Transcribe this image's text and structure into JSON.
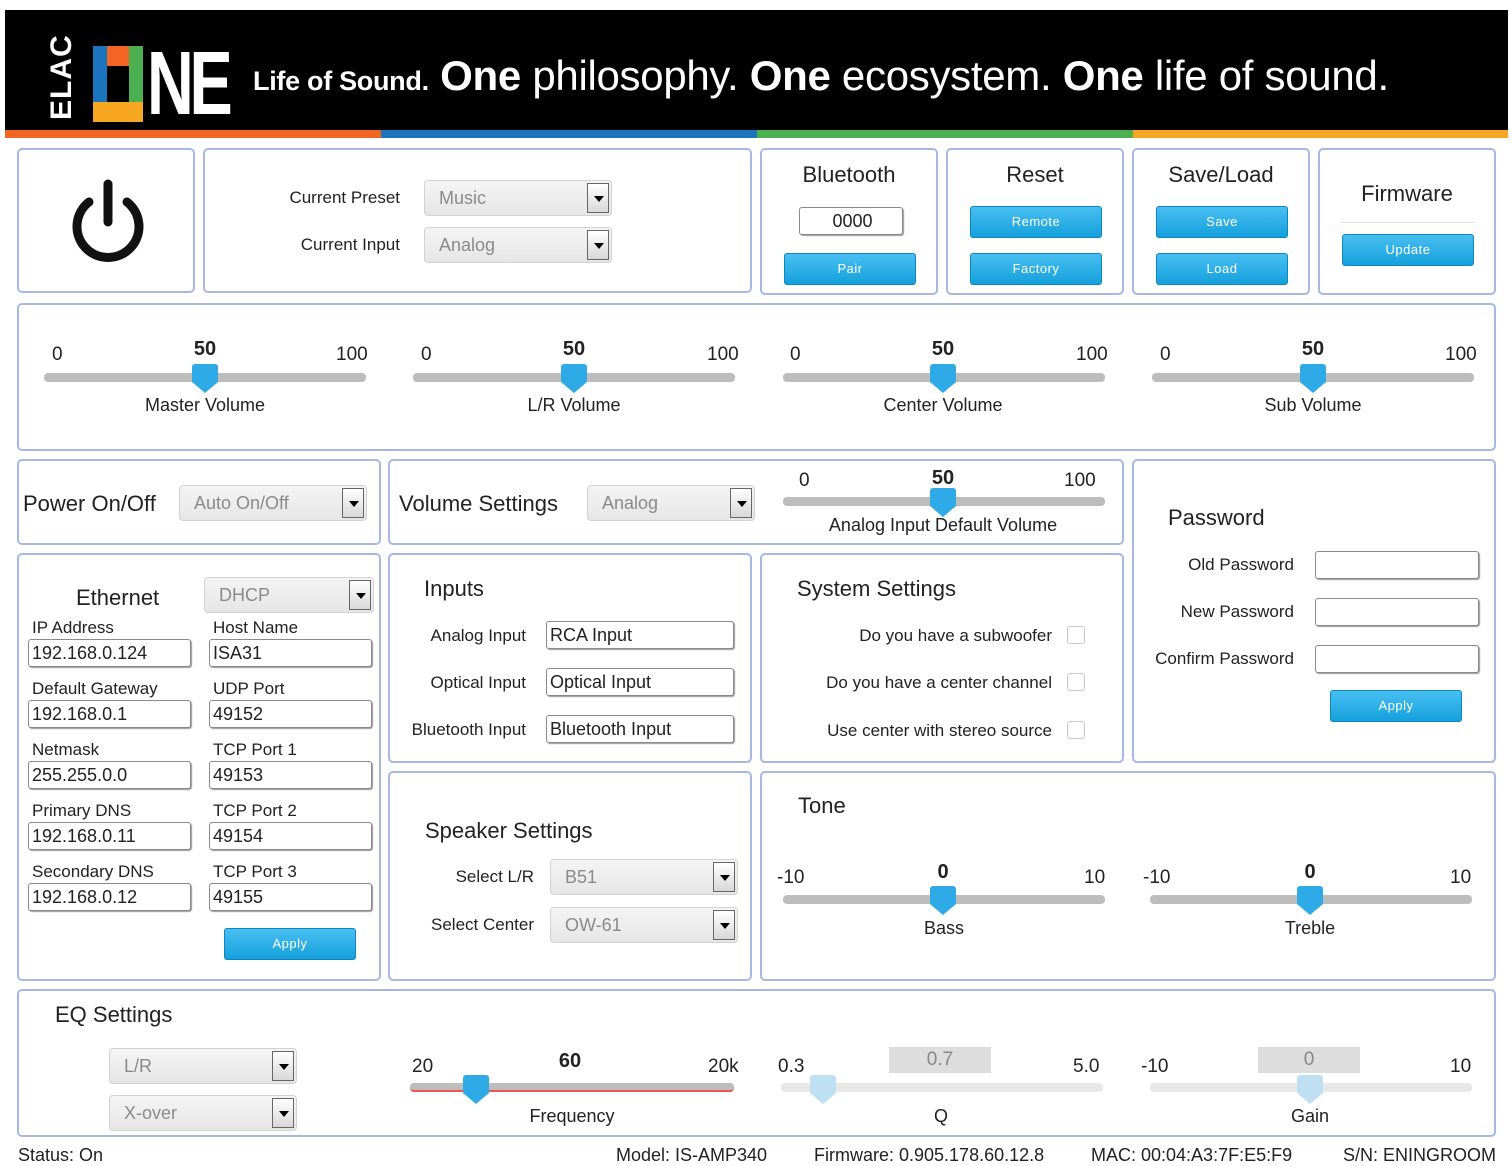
{
  "header": {
    "brand_elac": "ELAC",
    "brand_one": "NE",
    "tagline_lead": "Life of Sound.",
    "tagline_one1": "One",
    "tagline_p1": " philosophy. ",
    "tagline_one2": "One",
    "tagline_p2": " ecosystem. ",
    "tagline_one3": "One",
    "tagline_p3": " life of sound.",
    "stripe_colors": [
      "#f26522",
      "#1c75bc",
      "#4caf50",
      "#f7a823"
    ]
  },
  "power": {
    "icon": "power-icon"
  },
  "preset": {
    "current_preset_label": "Current Preset",
    "current_preset_value": "Music",
    "current_input_label": "Current Input",
    "current_input_value": "Analog"
  },
  "bluetooth": {
    "title": "Bluetooth",
    "pin": "0000",
    "pair_label": "Pair"
  },
  "reset": {
    "title": "Reset",
    "remote_label": "Remote",
    "factory_label": "Factory"
  },
  "saveload": {
    "title": "Save/Load",
    "save_label": "Save",
    "load_label": "Load"
  },
  "firmware": {
    "title": "Firmware",
    "update_label": "Update"
  },
  "volumes": [
    {
      "name": "Master Volume",
      "min": "0",
      "max": "100",
      "value": 50
    },
    {
      "name": "L/R Volume",
      "min": "0",
      "max": "100",
      "value": 50
    },
    {
      "name": "Center Volume",
      "min": "0",
      "max": "100",
      "value": 50
    },
    {
      "name": "Sub Volume",
      "min": "0",
      "max": "100",
      "value": 50
    }
  ],
  "power_onoff": {
    "title": "Power On/Off",
    "value": "Auto On/Off"
  },
  "volume_settings": {
    "title": "Volume Settings",
    "value": "Analog",
    "slider": {
      "name": "Analog Input Default Volume",
      "min": "0",
      "max": "100",
      "value": 50
    }
  },
  "password": {
    "title": "Password",
    "old_label": "Old Password",
    "new_label": "New Password",
    "confirm_label": "Confirm Password",
    "apply_label": "Apply"
  },
  "ethernet": {
    "title": "Ethernet",
    "mode": "DHCP",
    "ip_label": "IP Address",
    "ip_value": "192.168.0.124",
    "host_label": "Host Name",
    "host_value": "ISA31",
    "gateway_label": "Default Gateway",
    "gateway_value": "192.168.0.1",
    "udp_label": "UDP Port",
    "udp_value": "49152",
    "netmask_label": "Netmask",
    "netmask_value": "255.255.0.0",
    "tcp1_label": "TCP Port 1",
    "tcp1_value": "49153",
    "dns1_label": "Primary DNS",
    "dns1_value": "192.168.0.11",
    "tcp2_label": "TCP Port 2",
    "tcp2_value": "49154",
    "dns2_label": "Secondary DNS",
    "dns2_value": "192.168.0.12",
    "tcp3_label": "TCP Port 3",
    "tcp3_value": "49155",
    "apply_label": "Apply"
  },
  "inputs": {
    "title": "Inputs",
    "analog_label": "Analog Input",
    "analog_value": "RCA Input",
    "optical_label": "Optical Input",
    "optical_value": "Optical Input",
    "bt_label": "Bluetooth Input",
    "bt_value": "Bluetooth Input"
  },
  "system": {
    "title": "System Settings",
    "sub_label": "Do you have a subwoofer",
    "sub_checked": false,
    "center_label": "Do you have a center channel",
    "center_checked": false,
    "stereo_label": "Use center with stereo source",
    "stereo_checked": false
  },
  "speaker": {
    "title": "Speaker Settings",
    "lr_label": "Select L/R",
    "lr_value": "B51",
    "center_label": "Select Center",
    "center_value": "OW-61"
  },
  "tone": {
    "title": "Tone",
    "bass": {
      "name": "Bass",
      "min": "-10",
      "max": "10",
      "value": 0
    },
    "treble": {
      "name": "Treble",
      "min": "-10",
      "max": "10",
      "value": 0
    }
  },
  "eq": {
    "title": "EQ Settings",
    "channel": "L/R",
    "filter": "X-over",
    "frequency": {
      "name": "Frequency",
      "min": "20",
      "max": "20k",
      "value": "60"
    },
    "q": {
      "name": "Q",
      "min": "0.3",
      "max": "5.0",
      "value": "0.7"
    },
    "gain": {
      "name": "Gain",
      "min": "-10",
      "max": "10",
      "value": "0"
    }
  },
  "status_bar": {
    "status": "Status: On",
    "model": "Model: IS-AMP340",
    "firmware": "Firmware: 0.905.178.60.12.8",
    "mac": "MAC: 00:04:A3:7F:E5:F9",
    "sn": "S/N: ENINGROOM"
  }
}
